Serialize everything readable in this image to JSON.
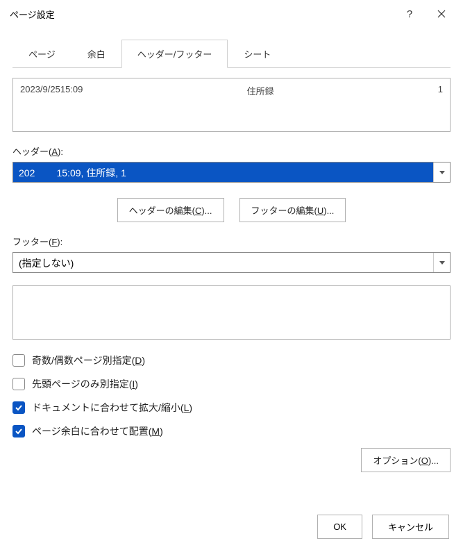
{
  "window": {
    "title": "ページ設定"
  },
  "tabs": {
    "page": "ページ",
    "margins": "余白",
    "header_footer": "ヘッダー/フッター",
    "sheet": "シート"
  },
  "header_preview": {
    "left": "2023/9/2515:09",
    "center": "住所録",
    "right": "1"
  },
  "labels": {
    "header_base": "ヘッダー(",
    "header_mn": "A",
    "header_suf": "):",
    "footer_base": "フッター(",
    "footer_mn": "F",
    "footer_suf": "):"
  },
  "header_combo": "202        15:09, 住所録, 1",
  "footer_combo": "(指定しない)",
  "buttons": {
    "edit_header_base": "ヘッダーの編集(",
    "edit_header_mn": "C",
    "edit_header_suf": ")...",
    "edit_footer_base": "フッターの編集(",
    "edit_footer_mn": "U",
    "edit_footer_suf": ")...",
    "options_base": "オプション(",
    "options_mn": "O",
    "options_suf": ")...",
    "ok": "OK",
    "cancel": "キャンセル"
  },
  "checkboxes": {
    "odd_even": {
      "checked": false,
      "label_base": "奇数/偶数ページ別指定(",
      "label_mn": "D",
      "label_suf": ")"
    },
    "first_page": {
      "checked": false,
      "label_base": "先頭ページのみ別指定(",
      "label_mn": "I",
      "label_suf": ")"
    },
    "scale_doc": {
      "checked": true,
      "label_base": "ドキュメントに合わせて拡大/縮小(",
      "label_mn": "L",
      "label_suf": ")"
    },
    "align_margins": {
      "checked": true,
      "label_base": "ページ余白に合わせて配置(",
      "label_mn": "M",
      "label_suf": ")"
    }
  }
}
